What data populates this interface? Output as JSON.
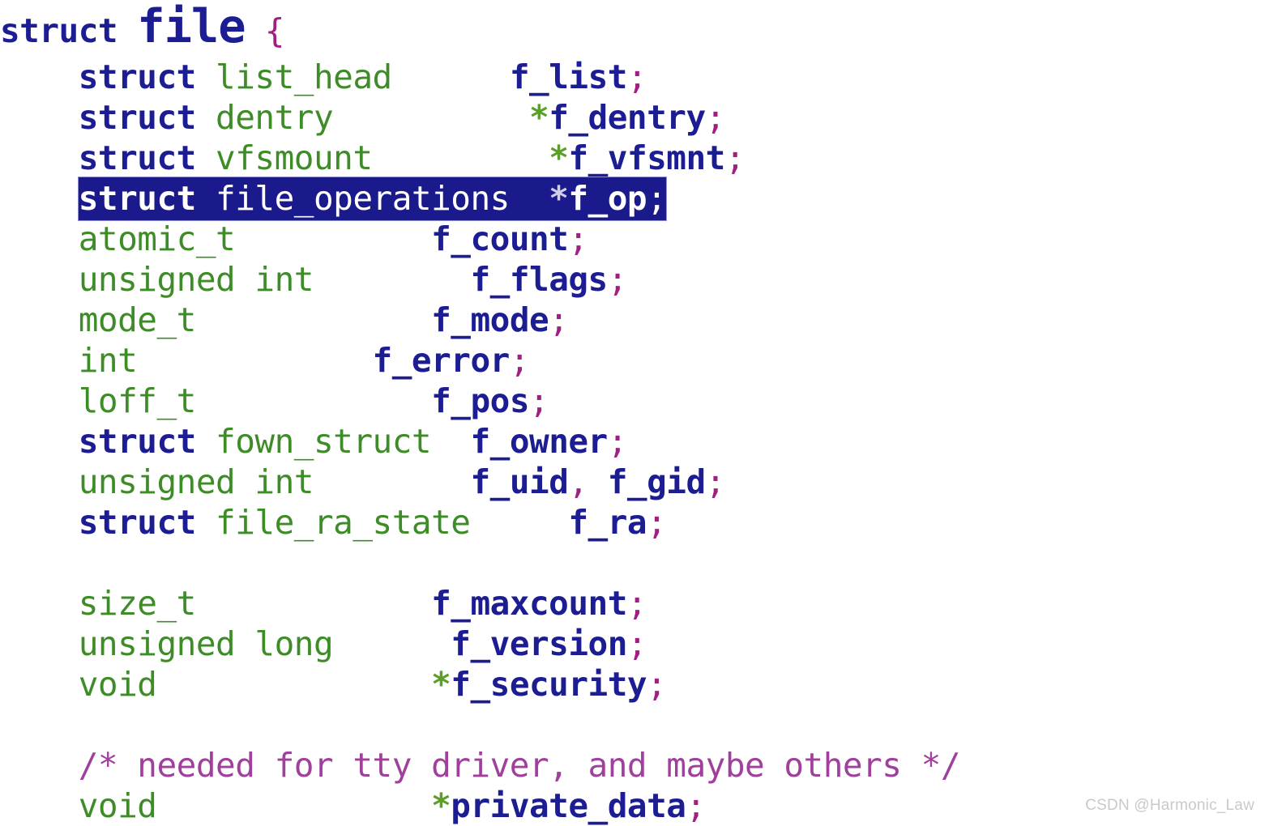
{
  "document": {
    "kind": "source-code-listing",
    "language": "C",
    "background_color": "#ffffff"
  },
  "theme": {
    "keyword_color": "#1d1d93",
    "type_color": "#3e8c28",
    "identifier_color": "#1d1d93",
    "pointer_star_color": "#5c9e2a",
    "punctuation_color": "#a11f80",
    "comment_color": "#a0409c",
    "highlight_background": "#1a1a8c",
    "highlight_foreground": "#ffffff",
    "watermark_color": "#c9c9c9"
  },
  "code": {
    "line01": {
      "kw": "struct",
      "space1": " ",
      "name": "file",
      "space2": " ",
      "brace": "{"
    },
    "line02": {
      "indent": "    ",
      "kw": "struct",
      "sp1": " ",
      "type": "list_head",
      "sp2": "      ",
      "id": "f_list",
      "semi": ";"
    },
    "line03": {
      "indent": "    ",
      "kw": "struct",
      "sp1": " ",
      "type": "dentry",
      "sp2": "          ",
      "star": "*",
      "id": "f_dentry",
      "semi": ";"
    },
    "line04": {
      "indent": "    ",
      "kw": "struct",
      "sp1": " ",
      "type": "vfsmount",
      "sp2": "         ",
      "star": "*",
      "id": "f_vfsmnt",
      "semi": ";"
    },
    "line05": {
      "indent": "    ",
      "kw": "struct",
      "sp1": " ",
      "type": "file_operations",
      "sp2": "  ",
      "star": "*",
      "id": "f_op",
      "semi": ";",
      "highlighted": true
    },
    "line06": {
      "indent": "    ",
      "type": "atomic_t",
      "sp2": "          ",
      "id": "f_count",
      "semi": ";"
    },
    "line07": {
      "indent": "    ",
      "type": "unsigned int",
      "sp2": "        ",
      "id": "f_flags",
      "semi": ";"
    },
    "line08": {
      "indent": "    ",
      "type": "mode_t",
      "sp2": "            ",
      "id": "f_mode",
      "semi": ";"
    },
    "line09": {
      "indent": "    ",
      "type": "int",
      "sp2": "            ",
      "id": "f_error",
      "semi": ";"
    },
    "line10": {
      "indent": "    ",
      "type": "loff_t",
      "sp2": "            ",
      "id": "f_pos",
      "semi": ";"
    },
    "line11": {
      "indent": "    ",
      "kw": "struct",
      "sp1": " ",
      "type": "fown_struct",
      "sp2": "  ",
      "id": "f_owner",
      "semi": ";"
    },
    "line12": {
      "indent": "    ",
      "type": "unsigned int",
      "sp2": "        ",
      "id1": "f_uid",
      "comma": ",",
      "sp3": " ",
      "id2": "f_gid",
      "semi": ";"
    },
    "line13": {
      "indent": "    ",
      "kw": "struct",
      "sp1": " ",
      "type": "file_ra_state",
      "sp2": "     ",
      "id": "f_ra",
      "semi": ";"
    },
    "line14": {
      "blank": ""
    },
    "line15": {
      "indent": "    ",
      "type": "size_t",
      "sp2": "            ",
      "id": "f_maxcount",
      "semi": ";"
    },
    "line16": {
      "indent": "    ",
      "type": "unsigned long",
      "sp2": "      ",
      "id": "f_version",
      "semi": ";"
    },
    "line17": {
      "indent": "    ",
      "type": "void",
      "sp2": "              ",
      "star": "*",
      "id": "f_security",
      "semi": ";"
    },
    "line18": {
      "blank": ""
    },
    "line19": {
      "indent": "    ",
      "comment": "/* needed for tty driver, and maybe others */"
    },
    "line20": {
      "indent": "    ",
      "type": "void",
      "sp2": "              ",
      "star": "*",
      "id": "private_data",
      "semi": ";"
    }
  },
  "watermark": {
    "text": "CSDN @Harmonic_Law"
  }
}
